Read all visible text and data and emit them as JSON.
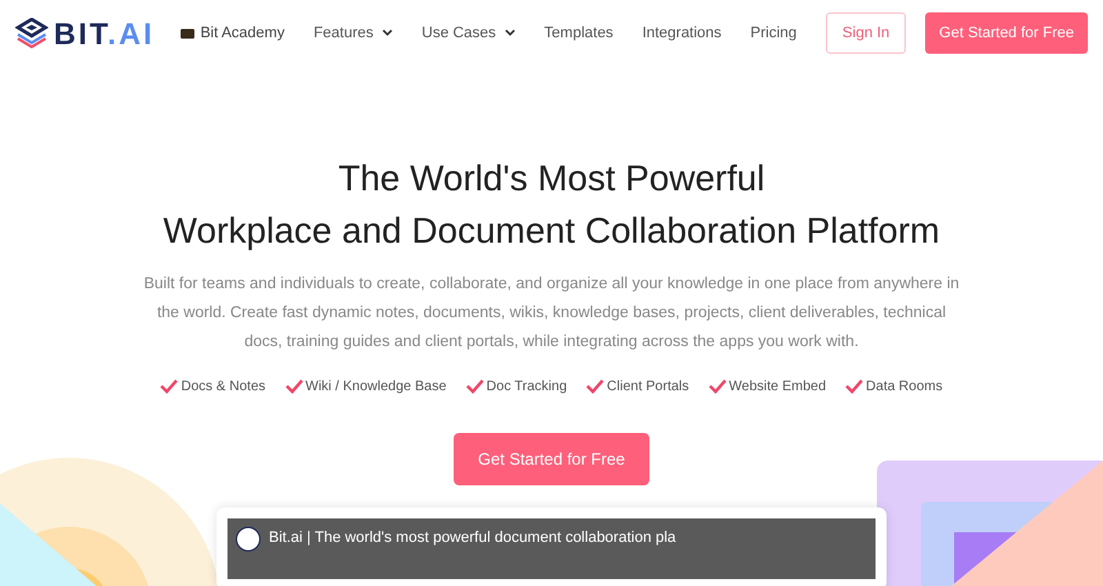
{
  "logo": {
    "text": "BIT",
    "accent": ".AI"
  },
  "nav": {
    "items": [
      {
        "label": "Bit Academy",
        "kind": "academy"
      },
      {
        "label": "Features",
        "kind": "dropdown"
      },
      {
        "label": "Use Cases",
        "kind": "dropdown"
      },
      {
        "label": "Templates",
        "kind": "link"
      },
      {
        "label": "Integrations",
        "kind": "link"
      },
      {
        "label": "Pricing",
        "kind": "link"
      }
    ],
    "sign_in": "Sign In",
    "cta": "Get Started for Free"
  },
  "hero": {
    "title_lines": [
      "The World's Most Powerful",
      "Workplace and Document Collaboration Platform"
    ],
    "description": "Built for teams and individuals to create, collaborate, and organize all your knowledge in one place from anywhere in the world. Create fast dynamic notes, documents, wikis, knowledge bases, projects, client deliverables, technical docs, training guides and client portals, while integrating across the apps you work with.",
    "features": [
      "Docs & Notes",
      "Wiki / Knowledge Base",
      "Doc Tracking",
      "Client Portals",
      "Website Embed",
      "Data Rooms"
    ],
    "cta": "Get Started for Free"
  },
  "video": {
    "title": "Bit.ai | The world's most powerful document collaboration pla"
  }
}
